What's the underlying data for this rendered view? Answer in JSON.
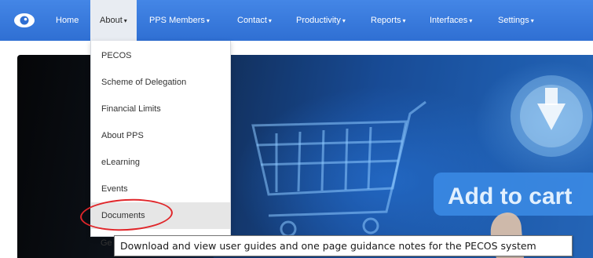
{
  "navbar": {
    "logo_icon": "eye-logo-icon",
    "items": [
      {
        "label": "Home",
        "has_caret": false
      },
      {
        "label": "About",
        "has_caret": true
      },
      {
        "label": "PPS Members",
        "has_caret": true
      },
      {
        "label": "Contact",
        "has_caret": true
      },
      {
        "label": "Productivity",
        "has_caret": true
      },
      {
        "label": "Reports",
        "has_caret": true
      },
      {
        "label": "Interfaces",
        "has_caret": true
      },
      {
        "label": "Settings",
        "has_caret": true
      }
    ],
    "caret_glyph": "▾",
    "active_item": "About"
  },
  "about_menu": {
    "items": [
      {
        "label": "PECOS"
      },
      {
        "label": "Scheme of Delegation"
      },
      {
        "label": "Financial Limits"
      },
      {
        "label": "About PPS"
      },
      {
        "label": "eLearning"
      },
      {
        "label": "Events"
      },
      {
        "label": "Documents"
      },
      {
        "label": "Ge"
      }
    ],
    "hovered_item": "Documents"
  },
  "hero": {
    "image_text": "Add to cart"
  },
  "tooltip": {
    "text": "Download and view user guides and one page guidance notes for the PECOS system"
  },
  "colors": {
    "navbar": "#3a7de0",
    "annotation": "#e0262a",
    "menu_hover": "#e6e6e6"
  }
}
